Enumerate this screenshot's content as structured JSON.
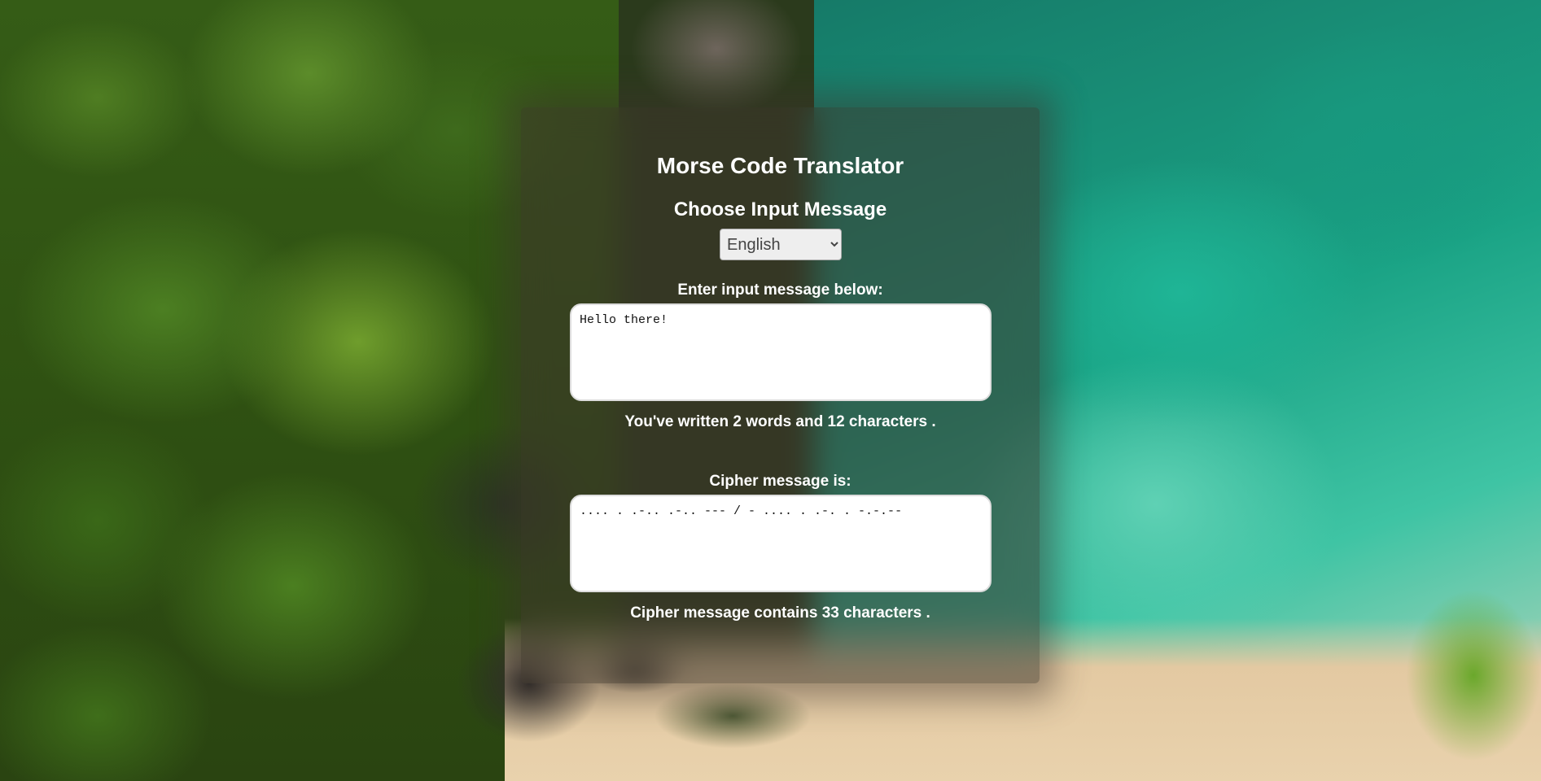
{
  "app": {
    "title": "Morse Code Translator",
    "subtitle": "Choose Input Message"
  },
  "language_select": {
    "selected": "English",
    "options": [
      "English"
    ]
  },
  "input": {
    "label": "Enter input message below:",
    "value": "Hello there!",
    "count_prefix": "You've written",
    "word_count": "2",
    "words_label": "words and",
    "char_count": "12",
    "chars_label": "characters ."
  },
  "cipher": {
    "label": "Cipher message is:",
    "value": ".... . .-.. .-.. --- / - .... . .-. . -.-.--",
    "count_prefix": "Cipher message contains",
    "char_count": "33",
    "chars_label": "characters ."
  }
}
